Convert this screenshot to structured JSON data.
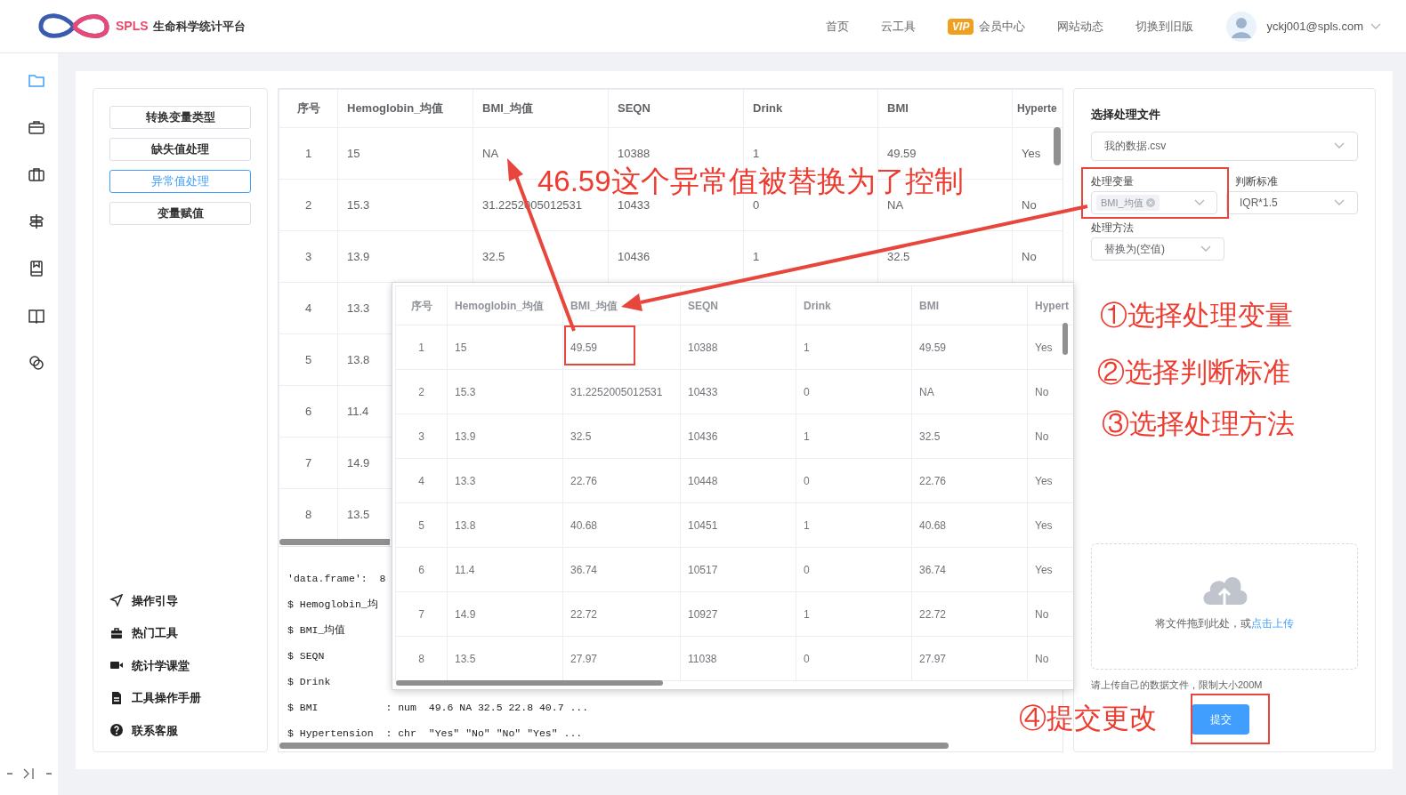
{
  "header": {
    "logo_text": "SPLS",
    "logo_subtitle": "生命科学统计平台",
    "nav": [
      {
        "label": "首页"
      },
      {
        "label": "云工具"
      },
      {
        "label": "会员中心",
        "badge": "VIP"
      },
      {
        "label": "网站动态"
      },
      {
        "label": "切换到旧版"
      }
    ],
    "user": "yckj001@spls.com"
  },
  "sidebar": {
    "items": [
      {
        "kind": "folder",
        "selected": true
      },
      {
        "kind": "briefcase",
        "selected": false
      },
      {
        "kind": "toolbox",
        "selected": false
      },
      {
        "kind": "signpost",
        "selected": false
      },
      {
        "kind": "bookmark",
        "selected": false
      },
      {
        "kind": "book",
        "selected": false
      },
      {
        "kind": "link",
        "selected": false
      }
    ]
  },
  "tool_menu": [
    {
      "label": "转换变量类型",
      "selected": false
    },
    {
      "label": "缺失值处理",
      "selected": false
    },
    {
      "label": "异常值处理",
      "selected": true
    },
    {
      "label": "变量赋值",
      "selected": false
    }
  ],
  "help_links": [
    {
      "kind": "guide",
      "label": "操作引导"
    },
    {
      "kind": "tools",
      "label": "热门工具"
    },
    {
      "kind": "video",
      "label": "统计学课堂"
    },
    {
      "kind": "manual",
      "label": "工具操作手册"
    },
    {
      "kind": "help",
      "label": "联系客服"
    }
  ],
  "table": {
    "columns": [
      "序号",
      "Hemoglobin_均值",
      "BMI_均值",
      "SEQN",
      "Drink",
      "BMI",
      "Hyperte"
    ],
    "rows": [
      [
        "1",
        "15",
        "NA",
        "10388",
        "1",
        "49.59",
        "Yes"
      ],
      [
        "2",
        "15.3",
        "31.2252005012531",
        "10433",
        "0",
        "NA",
        "No"
      ],
      [
        "3",
        "13.9",
        "32.5",
        "10436",
        "1",
        "32.5",
        "No"
      ],
      [
        "4",
        "13.3"
      ],
      [
        "5",
        "13.8"
      ],
      [
        "6",
        "11.4"
      ],
      [
        "7",
        "14.9"
      ],
      [
        "8",
        "13.5"
      ]
    ]
  },
  "console": {
    "lines": [
      "'data.frame':  8",
      "$ Hemoglobin_均",
      "$ BMI_均值",
      "$ SEQN",
      "$ Drink",
      "$ BMI           : num  49.6 NA 32.5 22.8 40.7 ...",
      "$ Hypertension  : chr  \"Yes\" \"No\" \"No\" \"Yes\" ..."
    ]
  },
  "inset_table": {
    "columns": [
      "序号",
      "Hemoglobin_均值",
      "BMI_均值",
      "SEQN",
      "Drink",
      "BMI",
      "Hypert"
    ],
    "rows": [
      [
        "1",
        "15",
        "49.59",
        "10388",
        "1",
        "49.59",
        "Yes"
      ],
      [
        "2",
        "15.3",
        "31.2252005012531",
        "10433",
        "0",
        "NA",
        "No"
      ],
      [
        "3",
        "13.9",
        "32.5",
        "10436",
        "1",
        "32.5",
        "No"
      ],
      [
        "4",
        "13.3",
        "22.76",
        "10448",
        "0",
        "22.76",
        "Yes"
      ],
      [
        "5",
        "13.8",
        "40.68",
        "10451",
        "1",
        "40.68",
        "Yes"
      ],
      [
        "6",
        "11.4",
        "36.74",
        "10517",
        "0",
        "36.74",
        "Yes"
      ],
      [
        "7",
        "14.9",
        "22.72",
        "10927",
        "1",
        "22.72",
        "No"
      ],
      [
        "8",
        "13.5",
        "27.97",
        "11038",
        "0",
        "27.97",
        "No"
      ]
    ]
  },
  "right_panel": {
    "file_label": "选择处理文件",
    "file_value": "我的数据.csv",
    "variable_label": "处理变量",
    "variable_tag": "BMI_均值",
    "criterion_label": "判断标准",
    "criterion_value": "IQR*1.5",
    "method_label": "处理方法",
    "method_value": "替换为(空值)",
    "upload_text": "将文件拖到此处，或",
    "upload_link": "点击上传",
    "upload_hint": "请上传自己的数据文件，限制大小200M",
    "submit": "提交"
  },
  "annotations": {
    "title": "46.59这个异常值被替换为了控制",
    "steps": [
      "①选择处理变量",
      "②选择判断标准",
      "③选择处理方法"
    ],
    "submit_step": "④提交更改"
  }
}
